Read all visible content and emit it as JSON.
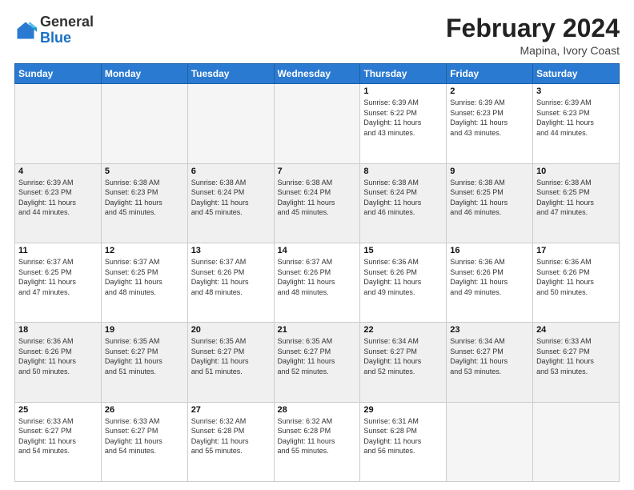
{
  "header": {
    "logo_general": "General",
    "logo_blue": "Blue",
    "month_year": "February 2024",
    "location": "Mapina, Ivory Coast"
  },
  "days_of_week": [
    "Sunday",
    "Monday",
    "Tuesday",
    "Wednesday",
    "Thursday",
    "Friday",
    "Saturday"
  ],
  "weeks": [
    [
      {
        "day": "",
        "info": "",
        "empty": true
      },
      {
        "day": "",
        "info": "",
        "empty": true
      },
      {
        "day": "",
        "info": "",
        "empty": true
      },
      {
        "day": "",
        "info": "",
        "empty": true
      },
      {
        "day": "1",
        "info": "Sunrise: 6:39 AM\nSunset: 6:22 PM\nDaylight: 11 hours\nand 43 minutes.",
        "empty": false
      },
      {
        "day": "2",
        "info": "Sunrise: 6:39 AM\nSunset: 6:23 PM\nDaylight: 11 hours\nand 43 minutes.",
        "empty": false
      },
      {
        "day": "3",
        "info": "Sunrise: 6:39 AM\nSunset: 6:23 PM\nDaylight: 11 hours\nand 44 minutes.",
        "empty": false
      }
    ],
    [
      {
        "day": "4",
        "info": "Sunrise: 6:39 AM\nSunset: 6:23 PM\nDaylight: 11 hours\nand 44 minutes.",
        "empty": false
      },
      {
        "day": "5",
        "info": "Sunrise: 6:38 AM\nSunset: 6:23 PM\nDaylight: 11 hours\nand 45 minutes.",
        "empty": false
      },
      {
        "day": "6",
        "info": "Sunrise: 6:38 AM\nSunset: 6:24 PM\nDaylight: 11 hours\nand 45 minutes.",
        "empty": false
      },
      {
        "day": "7",
        "info": "Sunrise: 6:38 AM\nSunset: 6:24 PM\nDaylight: 11 hours\nand 45 minutes.",
        "empty": false
      },
      {
        "day": "8",
        "info": "Sunrise: 6:38 AM\nSunset: 6:24 PM\nDaylight: 11 hours\nand 46 minutes.",
        "empty": false
      },
      {
        "day": "9",
        "info": "Sunrise: 6:38 AM\nSunset: 6:25 PM\nDaylight: 11 hours\nand 46 minutes.",
        "empty": false
      },
      {
        "day": "10",
        "info": "Sunrise: 6:38 AM\nSunset: 6:25 PM\nDaylight: 11 hours\nand 47 minutes.",
        "empty": false
      }
    ],
    [
      {
        "day": "11",
        "info": "Sunrise: 6:37 AM\nSunset: 6:25 PM\nDaylight: 11 hours\nand 47 minutes.",
        "empty": false
      },
      {
        "day": "12",
        "info": "Sunrise: 6:37 AM\nSunset: 6:25 PM\nDaylight: 11 hours\nand 48 minutes.",
        "empty": false
      },
      {
        "day": "13",
        "info": "Sunrise: 6:37 AM\nSunset: 6:26 PM\nDaylight: 11 hours\nand 48 minutes.",
        "empty": false
      },
      {
        "day": "14",
        "info": "Sunrise: 6:37 AM\nSunset: 6:26 PM\nDaylight: 11 hours\nand 48 minutes.",
        "empty": false
      },
      {
        "day": "15",
        "info": "Sunrise: 6:36 AM\nSunset: 6:26 PM\nDaylight: 11 hours\nand 49 minutes.",
        "empty": false
      },
      {
        "day": "16",
        "info": "Sunrise: 6:36 AM\nSunset: 6:26 PM\nDaylight: 11 hours\nand 49 minutes.",
        "empty": false
      },
      {
        "day": "17",
        "info": "Sunrise: 6:36 AM\nSunset: 6:26 PM\nDaylight: 11 hours\nand 50 minutes.",
        "empty": false
      }
    ],
    [
      {
        "day": "18",
        "info": "Sunrise: 6:36 AM\nSunset: 6:26 PM\nDaylight: 11 hours\nand 50 minutes.",
        "empty": false
      },
      {
        "day": "19",
        "info": "Sunrise: 6:35 AM\nSunset: 6:27 PM\nDaylight: 11 hours\nand 51 minutes.",
        "empty": false
      },
      {
        "day": "20",
        "info": "Sunrise: 6:35 AM\nSunset: 6:27 PM\nDaylight: 11 hours\nand 51 minutes.",
        "empty": false
      },
      {
        "day": "21",
        "info": "Sunrise: 6:35 AM\nSunset: 6:27 PM\nDaylight: 11 hours\nand 52 minutes.",
        "empty": false
      },
      {
        "day": "22",
        "info": "Sunrise: 6:34 AM\nSunset: 6:27 PM\nDaylight: 11 hours\nand 52 minutes.",
        "empty": false
      },
      {
        "day": "23",
        "info": "Sunrise: 6:34 AM\nSunset: 6:27 PM\nDaylight: 11 hours\nand 53 minutes.",
        "empty": false
      },
      {
        "day": "24",
        "info": "Sunrise: 6:33 AM\nSunset: 6:27 PM\nDaylight: 11 hours\nand 53 minutes.",
        "empty": false
      }
    ],
    [
      {
        "day": "25",
        "info": "Sunrise: 6:33 AM\nSunset: 6:27 PM\nDaylight: 11 hours\nand 54 minutes.",
        "empty": false
      },
      {
        "day": "26",
        "info": "Sunrise: 6:33 AM\nSunset: 6:27 PM\nDaylight: 11 hours\nand 54 minutes.",
        "empty": false
      },
      {
        "day": "27",
        "info": "Sunrise: 6:32 AM\nSunset: 6:28 PM\nDaylight: 11 hours\nand 55 minutes.",
        "empty": false
      },
      {
        "day": "28",
        "info": "Sunrise: 6:32 AM\nSunset: 6:28 PM\nDaylight: 11 hours\nand 55 minutes.",
        "empty": false
      },
      {
        "day": "29",
        "info": "Sunrise: 6:31 AM\nSunset: 6:28 PM\nDaylight: 11 hours\nand 56 minutes.",
        "empty": false
      },
      {
        "day": "",
        "info": "",
        "empty": true
      },
      {
        "day": "",
        "info": "",
        "empty": true
      }
    ]
  ]
}
